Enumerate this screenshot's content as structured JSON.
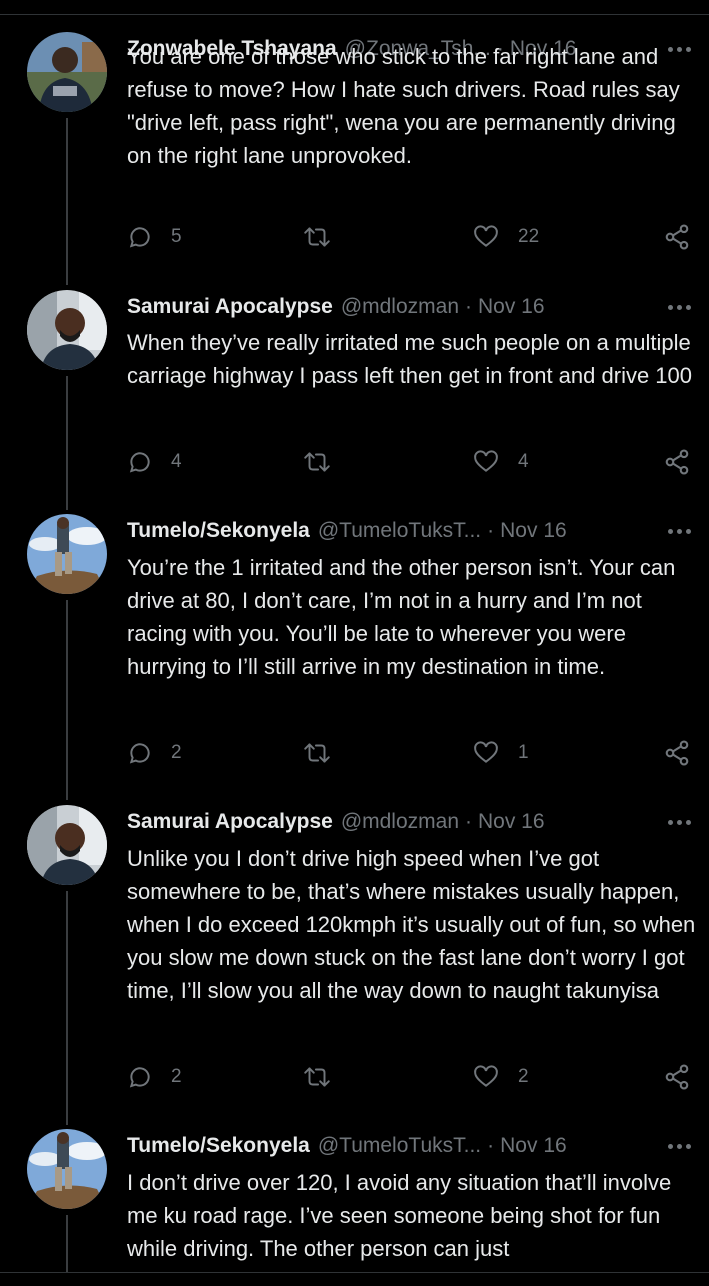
{
  "tweets": [
    {
      "name": "Zonwabele Tshayana",
      "handle": "@Zonwa_Tsh...",
      "date": "Nov 16",
      "text": "You are one of those who stick to the far right lane and refuse to move? How I hate such drivers. Road rules say \"drive left, pass right\", wena you are permanently driving on the right lane unprovoked.",
      "replies": "5",
      "retweets": "",
      "likes": "22",
      "avatar": "profile-photo-man-outdoors"
    },
    {
      "name": "Samurai Apocalypse",
      "handle": "@mdlozman",
      "date": "Nov 16",
      "text": "When they’ve really irritated me such people on a multiple carriage highway I pass left then get in front and drive 100",
      "replies": "4",
      "retweets": "",
      "likes": "4",
      "avatar": "profile-photo-man-in-car"
    },
    {
      "name": "Tumelo/Sekonyela",
      "handle": "@TumeloTuksT...",
      "date": "Nov 16",
      "text": "You’re the 1 irritated and the other person isn’t. Your can drive at 80, I don’t care, I’m not in a hurry and I’m not racing with you. You’ll be late to wherever you were hurrying to I’ll still arrive in my destination in time.",
      "replies": "2",
      "retweets": "",
      "likes": "1",
      "avatar": "profile-photo-person-on-rock"
    },
    {
      "name": "Samurai Apocalypse",
      "handle": "@mdlozman",
      "date": "Nov 16",
      "text": "Unlike you I don’t drive high speed when I’ve got somewhere to be, that’s where mistakes usually happen, when I do exceed 120kmph it’s usually out of fun, so when you slow me down stuck on the fast lane don’t worry I got time, I’ll slow you all the way down to naught takunyisa",
      "replies": "2",
      "retweets": "",
      "likes": "2",
      "avatar": "profile-photo-man-in-car"
    },
    {
      "name": "Tumelo/Sekonyela",
      "handle": "@TumeloTuksT...",
      "date": "Nov 16",
      "text": "I don’t drive over 120, I avoid any situation that’ll involve me ku road rage. I’ve seen someone being shot for fun while driving. The other person can just",
      "replies": "",
      "retweets": "",
      "likes": "",
      "avatar": "profile-photo-person-on-rock"
    }
  ],
  "icons": {
    "reply": "reply-icon",
    "retweet": "retweet-icon",
    "like": "like-icon",
    "share": "share-icon",
    "more": "more-options-icon"
  },
  "colors": {
    "background": "#000000",
    "text": "#e7e9ea",
    "secondary": "#71767b",
    "divider": "#2f3336"
  }
}
